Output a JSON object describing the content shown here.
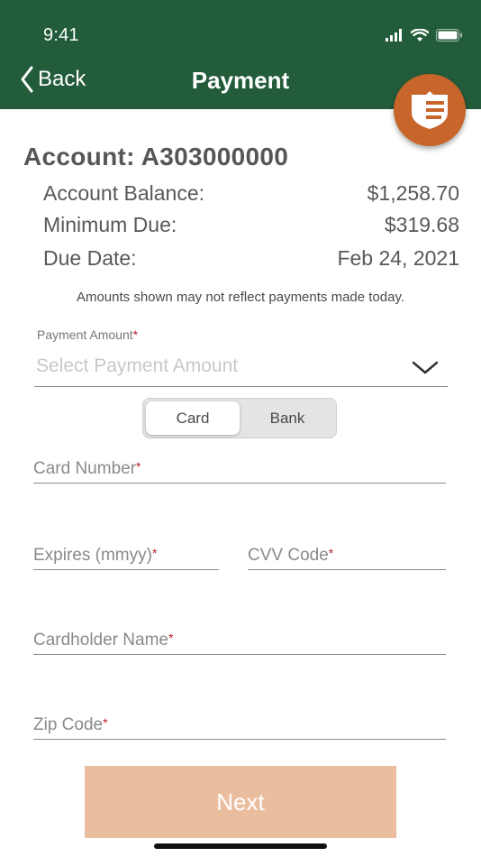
{
  "status_bar": {
    "time": "9:41"
  },
  "nav": {
    "back_label": "Back",
    "title": "Payment"
  },
  "account": {
    "title": "Account: A303000000",
    "rows": [
      {
        "label": "Account Balance:",
        "value": "$1,258.70"
      },
      {
        "label": "Minimum Due:",
        "value": "$319.68"
      },
      {
        "label": "Due Date:",
        "value": "Feb 24, 2021"
      }
    ],
    "disclaimer": "Amounts shown may not reflect payments made today."
  },
  "payment_amount": {
    "label": "Payment Amount",
    "required_mark": "*",
    "placeholder": "Select Payment Amount"
  },
  "method_toggle": {
    "options": [
      "Card",
      "Bank"
    ],
    "selected": "Card"
  },
  "fields": {
    "card_number": "Card Number",
    "expires": "Expires (mmyy)",
    "cvv": "CVV Code",
    "cardholder_name": "Cardholder Name",
    "zip_code": "Zip Code",
    "required_mark": "*"
  },
  "next_label": "Next",
  "colors": {
    "header_bg": "#235c3a",
    "badge_bg": "#c8652a",
    "next_button_bg": "#ebbd9f",
    "required": "#b3262d"
  }
}
